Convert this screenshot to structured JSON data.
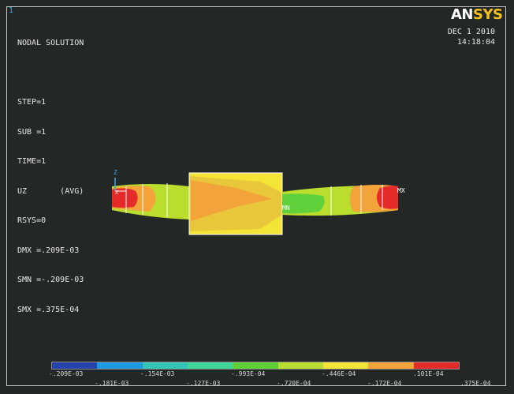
{
  "window_number": "1",
  "logo": {
    "part1": "AN",
    "part2": "SYS"
  },
  "info_lines": [
    "NODAL SOLUTION",
    "",
    "STEP=1",
    "SUB =1",
    "TIME=1",
    "UZ       (AVG)",
    "RSYS=0",
    "DMX =.209E-03",
    "SMN =-.209E-03",
    "SMX =.375E-04"
  ],
  "date": "DEC  1 2010",
  "time": "14:18:04",
  "markers": {
    "z_axis": "Z",
    "x_axis": "X",
    "min": "MN",
    "max": "MX"
  },
  "legend": {
    "colors": [
      "#2442a8",
      "#1e9be0",
      "#35c4b8",
      "#3fd59a",
      "#5fcf3a",
      "#b9de2e",
      "#f4e435",
      "#f2a43a",
      "#e52a2a"
    ],
    "top_labels": [
      "-.209E-03",
      "-.154E-03",
      "-.993E-04",
      "-.446E-04",
      ".101E-04"
    ],
    "bottom_labels": [
      "-.181E-03",
      "-.127E-03",
      "-.720E-04",
      "-.172E-04",
      ".375E-04"
    ]
  }
}
